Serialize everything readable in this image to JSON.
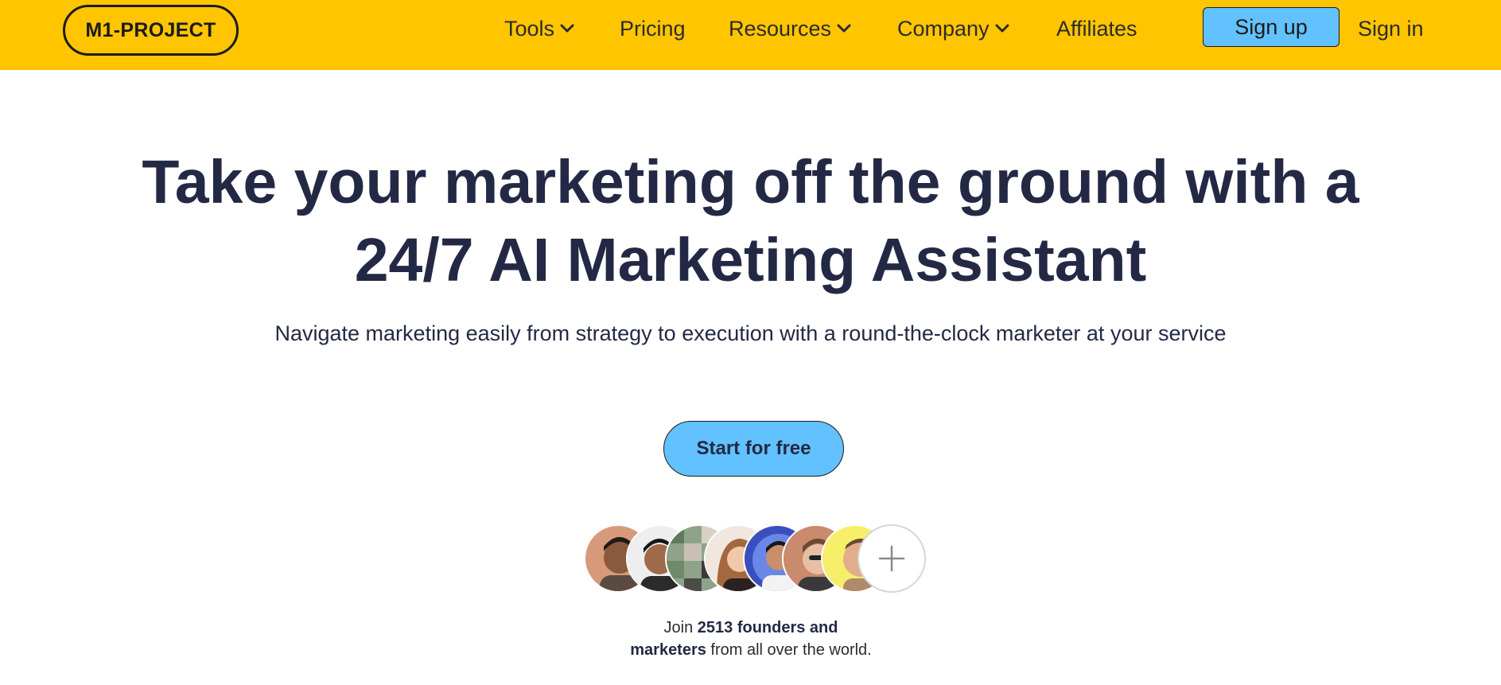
{
  "brand": {
    "logo_text": "M1-PROJECT"
  },
  "nav": {
    "tools": "Tools",
    "pricing": "Pricing",
    "resources": "Resources",
    "company": "Company",
    "affiliates": "Affiliates",
    "signup": "Sign up",
    "signin": "Sign in"
  },
  "hero": {
    "title_line1": "Take your marketing off the ground with a",
    "title_line2": "24/7 AI Marketing Assistant",
    "subtitle": "Navigate marketing easily from strategy to execution with a round-the-clock marketer at your service",
    "cta": "Start for free"
  },
  "social_proof": {
    "prefix": "Join ",
    "bold1": "2513 founders and",
    "bold2": "marketers",
    "suffix": " from all over the world.",
    "more_icon": "plus-icon"
  },
  "colors": {
    "nav_bg": "#ffc500",
    "button_bg": "#62c1ff",
    "heading": "#232945"
  }
}
